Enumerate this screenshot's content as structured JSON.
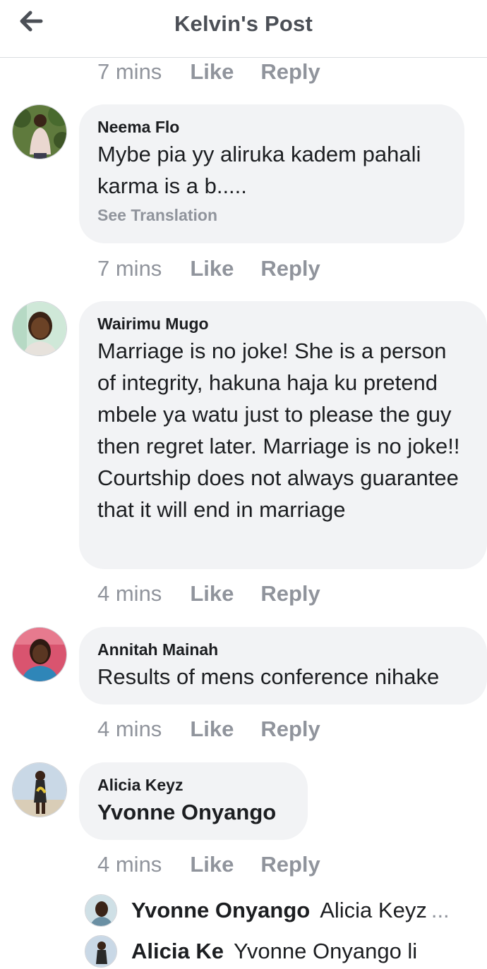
{
  "header": {
    "title": "Kelvin's Post",
    "back_icon": "arrow-left-icon"
  },
  "top_actions": {
    "time": "7 mins",
    "like_label": "Like",
    "reply_label": "Reply"
  },
  "comments": [
    {
      "author": "Neema Flo",
      "text": "Mybe pia yy aliruka kadem pahali karma is a b.....",
      "see_translation": "See Translation",
      "time": "7 mins",
      "like_label": "Like",
      "reply_label": "Reply"
    },
    {
      "author": "Wairimu Mugo",
      "text": "Marriage is no joke! She is a person of integrity, hakuna haja ku pretend mbele ya watu just to please the guy then regret later. Marriage is no joke!! Courtship does not always guarantee that it will end in marriage",
      "time": "4 mins",
      "like_label": "Like",
      "reply_label": "Reply"
    },
    {
      "author": "Annitah Mainah",
      "text": "Results of mens conference nihake",
      "time": "4 mins",
      "like_label": "Like",
      "reply_label": "Reply"
    },
    {
      "author": "Alicia Keyz",
      "mention": "Yvonne Onyango",
      "time": "4 mins",
      "like_label": "Like",
      "reply_label": "Reply",
      "replies": [
        {
          "author": "Yvonne Onyango",
          "text": "Alicia Keyz",
          "ellipsis": "..."
        },
        {
          "author": "Alicia Ke",
          "text": "Yvonne Onyango li"
        }
      ]
    }
  ],
  "colors": {
    "bubble": "#f2f3f5",
    "meta_text": "#90949c",
    "title_text": "#4b4f56",
    "body_text": "#1c1e21"
  }
}
